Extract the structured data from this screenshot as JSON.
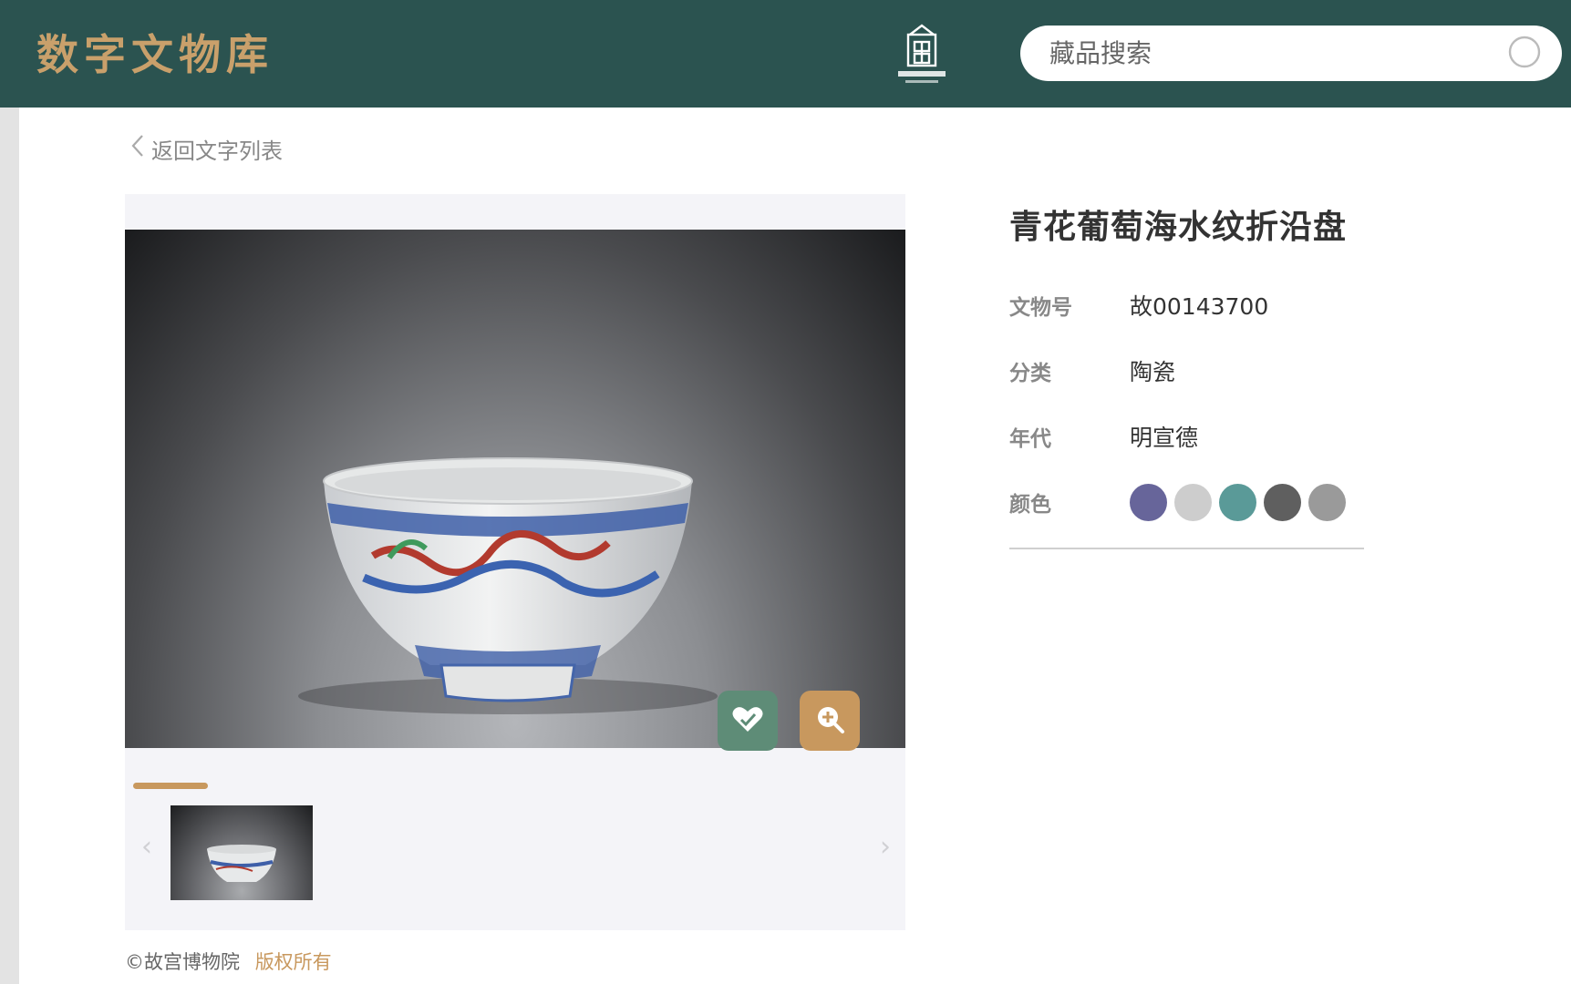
{
  "header": {
    "brand": "数字文物库",
    "search_placeholder": "藏品搜索"
  },
  "nav": {
    "back_label": "返回文字列表"
  },
  "artifact": {
    "title": "青花葡萄海水纹折沿盘",
    "attributes": [
      {
        "label": "文物号",
        "value": "故00143700"
      },
      {
        "label": "分类",
        "value": "陶瓷"
      },
      {
        "label": "年代",
        "value": "明宣德"
      },
      {
        "label": "颜色",
        "value": ""
      }
    ],
    "colors": [
      "#67659a",
      "#cdcdcd",
      "#5a9a98",
      "#5f5f5f",
      "#9a9a9a"
    ]
  },
  "gallery": {
    "progress": 0.1
  },
  "footer": {
    "copyright": "©故宫博物院",
    "rights": "版权所有"
  },
  "theme": {
    "header_bg": "#2b5350",
    "brand_gold": "#c9a06b",
    "accent_gold": "#c8985e",
    "fav_green": "#5e8c77"
  }
}
